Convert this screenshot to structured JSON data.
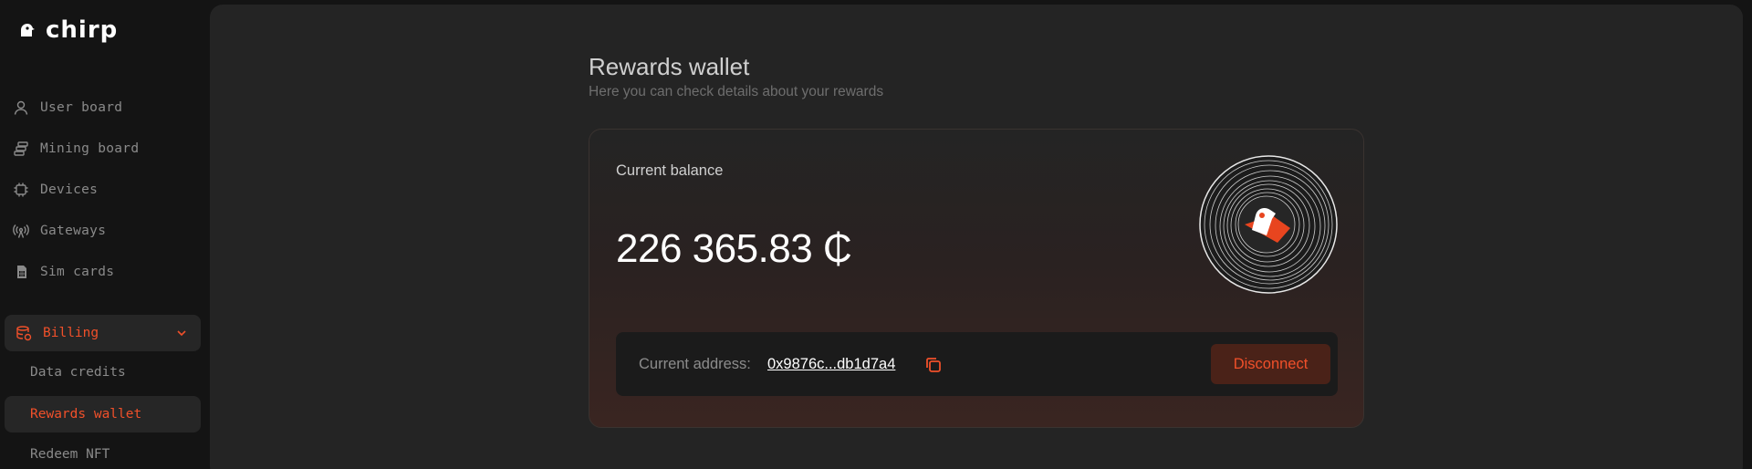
{
  "app": {
    "name": "chirp"
  },
  "sidebar": {
    "items": [
      {
        "label": "User board",
        "icon": "user-icon"
      },
      {
        "label": "Mining board",
        "icon": "mining-icon"
      },
      {
        "label": "Devices",
        "icon": "chip-icon"
      },
      {
        "label": "Gateways",
        "icon": "antenna-icon"
      },
      {
        "label": "Sim cards",
        "icon": "sim-card-icon"
      }
    ],
    "billing": {
      "label": "Billing",
      "icon": "database-icon",
      "expanded": true,
      "sub_items": [
        {
          "label": "Data credits",
          "active": false
        },
        {
          "label": "Rewards wallet",
          "active": true
        },
        {
          "label": "Redeem NFT",
          "active": false
        }
      ]
    }
  },
  "page": {
    "title": "Rewards wallet",
    "subtitle": "Here you can check details about your rewards"
  },
  "wallet": {
    "balance_label": "Current balance",
    "balance_value": "226 365.83 ₵",
    "address_label": "Current address:",
    "address_value": "0x9876c...db1d7a4",
    "disconnect_label": "Disconnect"
  },
  "colors": {
    "accent": "#f0502a",
    "background": "#141414",
    "panel": "#242424"
  }
}
